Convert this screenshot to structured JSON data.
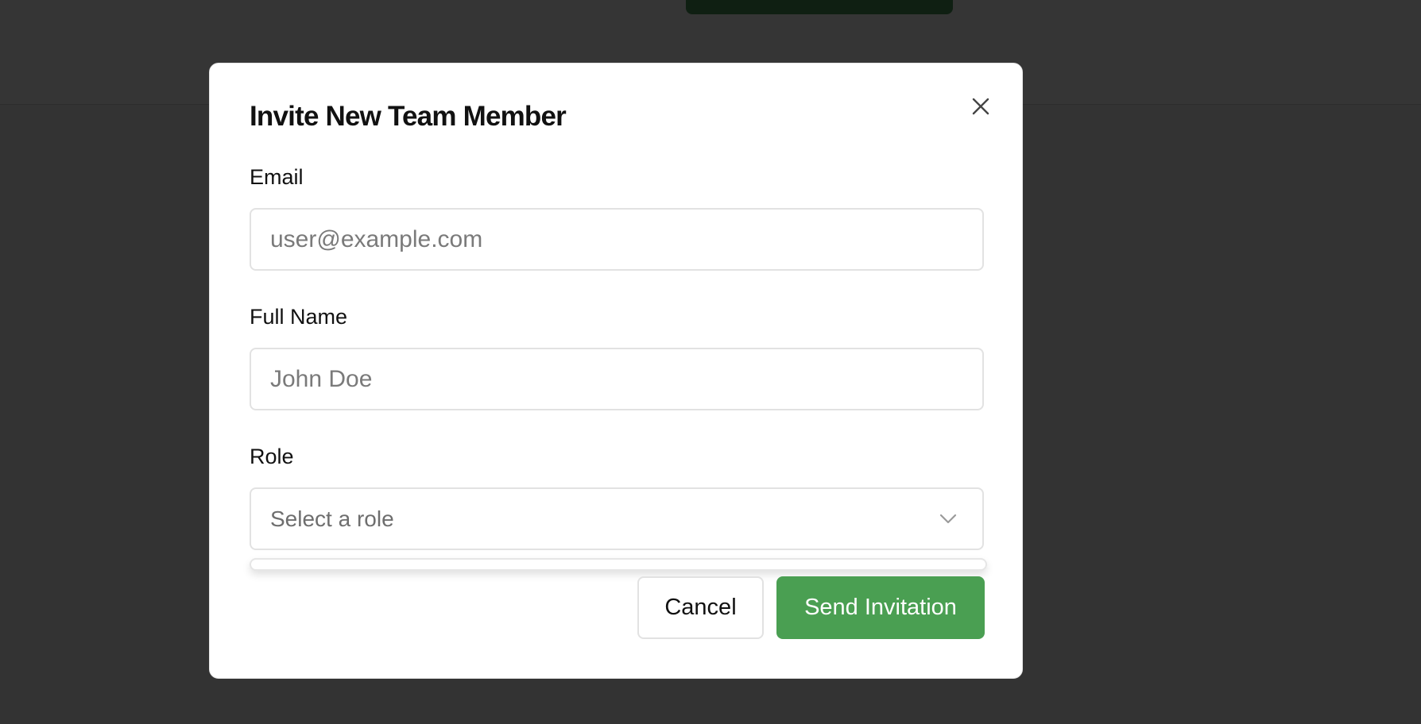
{
  "modal": {
    "title": "Invite New Team Member",
    "email": {
      "label": "Email",
      "placeholder": "user@example.com",
      "value": ""
    },
    "full_name": {
      "label": "Full Name",
      "placeholder": "John Doe",
      "value": ""
    },
    "role": {
      "label": "Role",
      "placeholder": "Select a role"
    },
    "actions": {
      "cancel_label": "Cancel",
      "send_label": "Send Invitation"
    }
  },
  "icons": {
    "close": "close-icon",
    "chevron": "chevron-down-icon"
  },
  "colors": {
    "primary": "#4a9f52",
    "backdrop": "#333333",
    "surface": "#ffffff",
    "border": "#e2e2e2"
  }
}
